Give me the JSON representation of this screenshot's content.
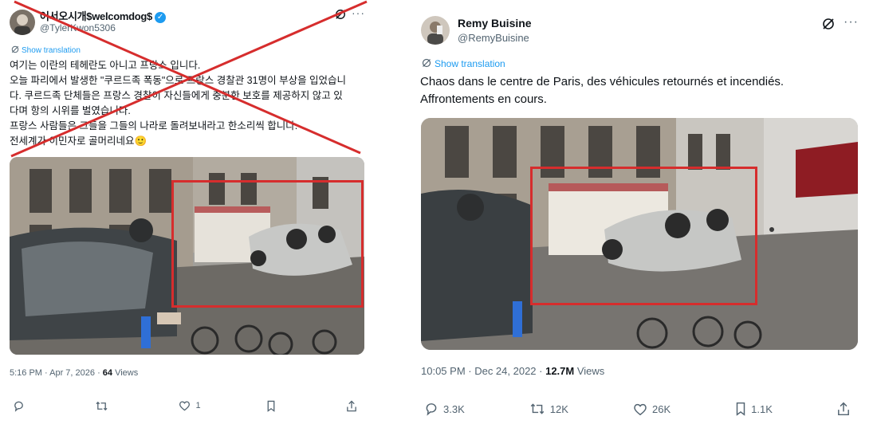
{
  "left_tweet": {
    "display_name": "어서오시개$welcomdog$",
    "handle": "@TylerKwon5306",
    "show_translation": "Show translation",
    "text_lines": [
      "여기는 이란의 테헤란도 아니고 프랑스 입니다.",
      "오늘 파리에서 발생한 \"쿠르드족 폭동\"으로 프랑스 경찰관 31명이 부상을 입었습니",
      "다. 쿠르드족 단체들은 프랑스 경찰이 자신들에게 충분한 보호를 제공하지 않고 있",
      "다며 항의 시위를 벌였습니다.",
      "프랑스 사람들은 그들을 그들의 나라로 돌려보내라고 한소리씩 합니다.",
      "전세계가 이민자로 골머리네요🙂"
    ],
    "timestamp": "5:16 PM · Apr 7, 2026 · ",
    "views_count": "64",
    "views_label": " Views",
    "actions": {
      "reply": "",
      "retweet": "",
      "like": "1",
      "bookmark": "",
      "share": ""
    }
  },
  "right_tweet": {
    "display_name": "Remy Buisine",
    "handle": "@RemyBuisine",
    "show_translation": "Show translation",
    "text_lines": [
      "Chaos dans le centre de Paris, des véhicules retournés et incendiés.",
      "Affrontements en cours."
    ],
    "timestamp": "10:05 PM · Dec 24, 2022 · ",
    "views_count": "12.7M",
    "views_label": " Views",
    "actions": {
      "reply": "3.3K",
      "retweet": "12K",
      "like": "26K",
      "bookmark": "1.1K",
      "share": ""
    }
  },
  "colors": {
    "highlight_box": "#d62d2d",
    "strike_lines": "#d62d2d",
    "link": "#1d9bf0"
  }
}
